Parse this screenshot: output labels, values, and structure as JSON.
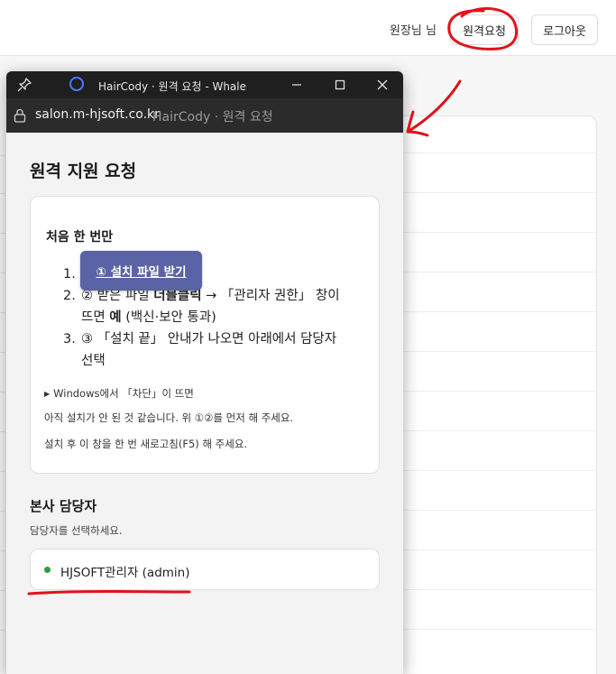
{
  "header": {
    "greeting": "원장님 님",
    "remote_request_label": "원격요청",
    "logout_label": "로그아웃"
  },
  "popup": {
    "window_title": "HairCody · 원격 요청 - Whale",
    "url_domain": "salon.m-hjsoft.co.kr",
    "url_page_title": "HairCody · 원격 요청",
    "page_heading": "원격 지원 요청",
    "first_time": {
      "title": "처음 한 번만",
      "download_button": "① 설치 파일 받기",
      "steps": [
        {
          "num": "1."
        },
        {
          "num": "2.",
          "a": "② 받은 파일 ",
          "b": "더블클릭",
          "c": " → 「관리자 권한」 창이 뜨면 ",
          "d": "예",
          "e": " (백신·보안 통과)"
        },
        {
          "num": "3.",
          "text": "③ 「설치 끝」 안내가 나오면 아래에서 담당자 선택"
        }
      ],
      "details_summary": "Windows에서 「차단」이 뜨면",
      "note_1": "아직 설치가 안 된 것 같습니다. 위 ①②를 먼저 해 주세요.",
      "note_2": "설치 후 이 창을 한 번 새로고침(F5) 해 주세요."
    },
    "staff": {
      "title": "본사 담당자",
      "subtitle": "담당자를 선택하세요.",
      "items": [
        {
          "name": "HJSOFT관리자 (admin)",
          "status_color": "#2e9b3f"
        }
      ]
    }
  },
  "colors": {
    "accent_button": "#5a63a5",
    "annotation": "#e0121b",
    "titlebar": "#1f1f1f"
  },
  "icons": [
    "pin-icon",
    "whale-icon",
    "minimize-icon",
    "maximize-icon",
    "close-icon",
    "lock-icon",
    "triangle-right-icon"
  ]
}
